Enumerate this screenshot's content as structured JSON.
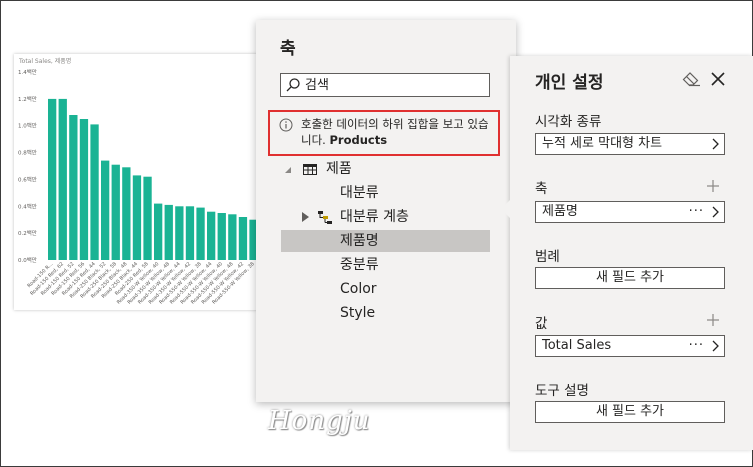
{
  "chart": {
    "title": "Total Sales, 제품명",
    "accent_color": "#1ab394"
  },
  "chart_data": {
    "type": "bar",
    "title": "Total Sales, 제품명",
    "ylim": [
      0,
      1.4
    ],
    "y_ticks": [
      "0.0백만",
      "0.2백만",
      "0.4백만",
      "0.6백만",
      "0.8백만",
      "1.0백만",
      "1.2백만",
      "1.4백만"
    ],
    "categories": [
      "Road-150 R...",
      "Road-150 Red, 62",
      "Road-150 Red, 52",
      "Road-150 Red, 56",
      "Road-150 Red, 44",
      "Road-250 Black, 52",
      "Road-250 Black, 58",
      "Road-250 Black, 48",
      "Road-250 Black, 44",
      "Road-250 Red, 58",
      "Road-350-W Yellow, 40",
      "Road-350-W Yellow, 48",
      "Road-350-W Yellow, 44",
      "Road-350-W Yellow, 42",
      "Road-550-W Yellow, 38",
      "Road-550-W Yellow, 44",
      "Road-550-W Yellow, 40",
      "Road-550-W Yellow, 48",
      "Road-550-W Yellow, 42",
      "Road-550-W Yellow, 38"
    ],
    "values": [
      1.2,
      1.2,
      1.08,
      1.05,
      1.01,
      0.74,
      0.71,
      0.69,
      0.63,
      0.62,
      0.42,
      0.41,
      0.4,
      0.4,
      0.39,
      0.36,
      0.35,
      0.34,
      0.32,
      0.3
    ],
    "grid": false
  },
  "axis_panel": {
    "title": "축",
    "search_placeholder": "검색",
    "info_text": "호출한 데이터의 하위 집합을 보고 있습니다.",
    "info_bold": "Products",
    "tree": {
      "table": "제품",
      "fields": {
        "f1": "대분류",
        "f2": "대분류 계층",
        "f3": "제품명",
        "f4": "중분류",
        "f5": "Color",
        "f6": "Style"
      }
    }
  },
  "settings": {
    "title": "개인 설정",
    "viz_type_label": "시각화 종류",
    "viz_type_value": "누적 세로 막대형 차트",
    "axis_label": "축",
    "axis_value": "제품명",
    "legend_label": "범례",
    "legend_button": "새 필드 추가",
    "values_label": "값",
    "values_value": "Total Sales",
    "tooltip_label": "도구 설명",
    "tooltip_button": "새 필드 추가",
    "more_glyph": "···"
  },
  "watermark": "Hongju"
}
